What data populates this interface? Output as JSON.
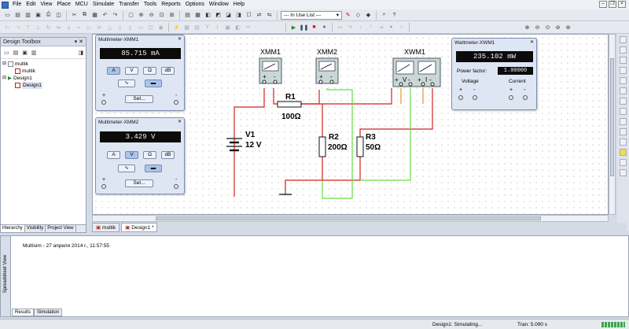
{
  "menu": {
    "items": [
      "File",
      "Edit",
      "View",
      "Place",
      "MCU",
      "Simulate",
      "Transfer",
      "Tools",
      "Reports",
      "Options",
      "Window",
      "Help"
    ]
  },
  "toolbar": {
    "in_use_list": "--- In Use List ---"
  },
  "toolbox": {
    "title": "Design Toolbox",
    "tree": [
      {
        "label": "multik",
        "level": 0
      },
      {
        "label": "multik",
        "level": 1
      },
      {
        "label": "Design1",
        "level": 0
      },
      {
        "label": "Design1",
        "level": 1
      }
    ],
    "tabs": [
      "Hierarchy",
      "Visibility",
      "Project View"
    ]
  },
  "instruments": {
    "xmm1": {
      "title": "Multimeter-XMM1",
      "reading": "85.715 mA",
      "buttons": [
        "A",
        "V",
        "Ω",
        "dB"
      ],
      "active": "A",
      "set_label": "Set...",
      "plus": "+",
      "minus": "-"
    },
    "xmm2": {
      "title": "Multimeter-XMM2",
      "reading": "3.429 V",
      "buttons": [
        "A",
        "V",
        "Ω",
        "dB"
      ],
      "active": "V",
      "set_label": "Set...",
      "plus": "+",
      "minus": "-"
    },
    "xwm1": {
      "title": "Wattmeter-XWM1",
      "reading": "235.102 mW",
      "power_factor_label": "Power factor:",
      "power_factor_value": "1.00000",
      "voltage_label": "Voltage",
      "current_label": "Current",
      "plus": "+",
      "minus": "-"
    }
  },
  "schematic": {
    "labels": {
      "xmm1": "XMM1",
      "xmm2": "XMM2",
      "xwm1": "XWM1",
      "v1": "V1",
      "v1_value": "12 V",
      "r1": "R1",
      "r1_value": "100Ω",
      "r2": "R2",
      "r2_value": "200Ω",
      "r3": "R3",
      "r3_value": "50Ω",
      "plus": "+",
      "minus": "-",
      "v_sym": "V",
      "i_sym": "I"
    },
    "colors": {
      "red_wire": "#d42020",
      "green_wire": "#66dd44",
      "orange_wire": "#e8962a"
    }
  },
  "doc_tabs": [
    "multik",
    "Design1 *"
  ],
  "spreadsheet": {
    "side_label": "Spreadsheet View",
    "log_line": "Multisim  -  27 апреля 2014 г., 11:57:55",
    "tabs": [
      "Results",
      "Simulation"
    ]
  },
  "status": {
    "state": "Design1: Simulating...",
    "tran": "Tran: 5.090 s"
  }
}
